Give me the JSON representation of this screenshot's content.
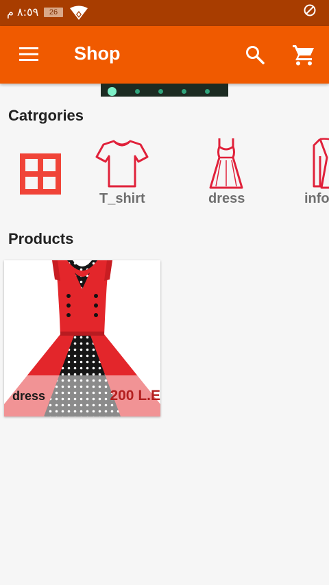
{
  "status_bar": {
    "time": "٨:٥٩ م",
    "battery": "26"
  },
  "app_bar": {
    "title": "Shop"
  },
  "categories_section": {
    "title": "Catrgories",
    "items": [
      {
        "label": "",
        "icon": "grid-icon"
      },
      {
        "label": "T_shirt",
        "icon": "tshirt-icon"
      },
      {
        "label": "dress",
        "icon": "dress-icon"
      },
      {
        "label": "info",
        "icon": "jacket-icon"
      }
    ]
  },
  "products_section": {
    "title": "Products",
    "items": [
      {
        "name": "dress",
        "price": "200 L.E"
      }
    ]
  },
  "colors": {
    "status_bar": "#a83d00",
    "app_bar": "#f05a00",
    "category_icon": "#e0213a",
    "grid_icon": "#f04438",
    "price": "#b31f1f"
  }
}
